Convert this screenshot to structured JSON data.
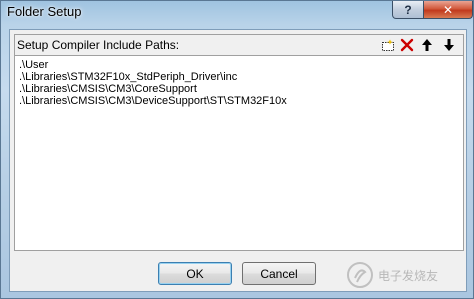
{
  "window": {
    "title": "Folder Setup",
    "help_label": "?",
    "close_label": "✕"
  },
  "group": {
    "label": "Setup Compiler Include Paths:",
    "toolbar": {
      "new_icon": "new-folder-icon",
      "delete_icon": "delete-x-icon",
      "move_up_icon": "arrow-up-icon",
      "move_down_icon": "arrow-down-icon"
    }
  },
  "paths": [
    ".\\User",
    ".\\Libraries\\STM32F10x_StdPeriph_Driver\\inc",
    ".\\Libraries\\CMSIS\\CM3\\CoreSupport",
    ".\\Libraries\\CMSIS\\CM3\\DeviceSupport\\ST\\STM32F10x"
  ],
  "buttons": {
    "ok": "OK",
    "cancel": "Cancel"
  },
  "colors": {
    "delete_red": "#cc0000",
    "close_red": "#c0391d"
  },
  "watermark": {
    "text": "电子发烧友"
  }
}
